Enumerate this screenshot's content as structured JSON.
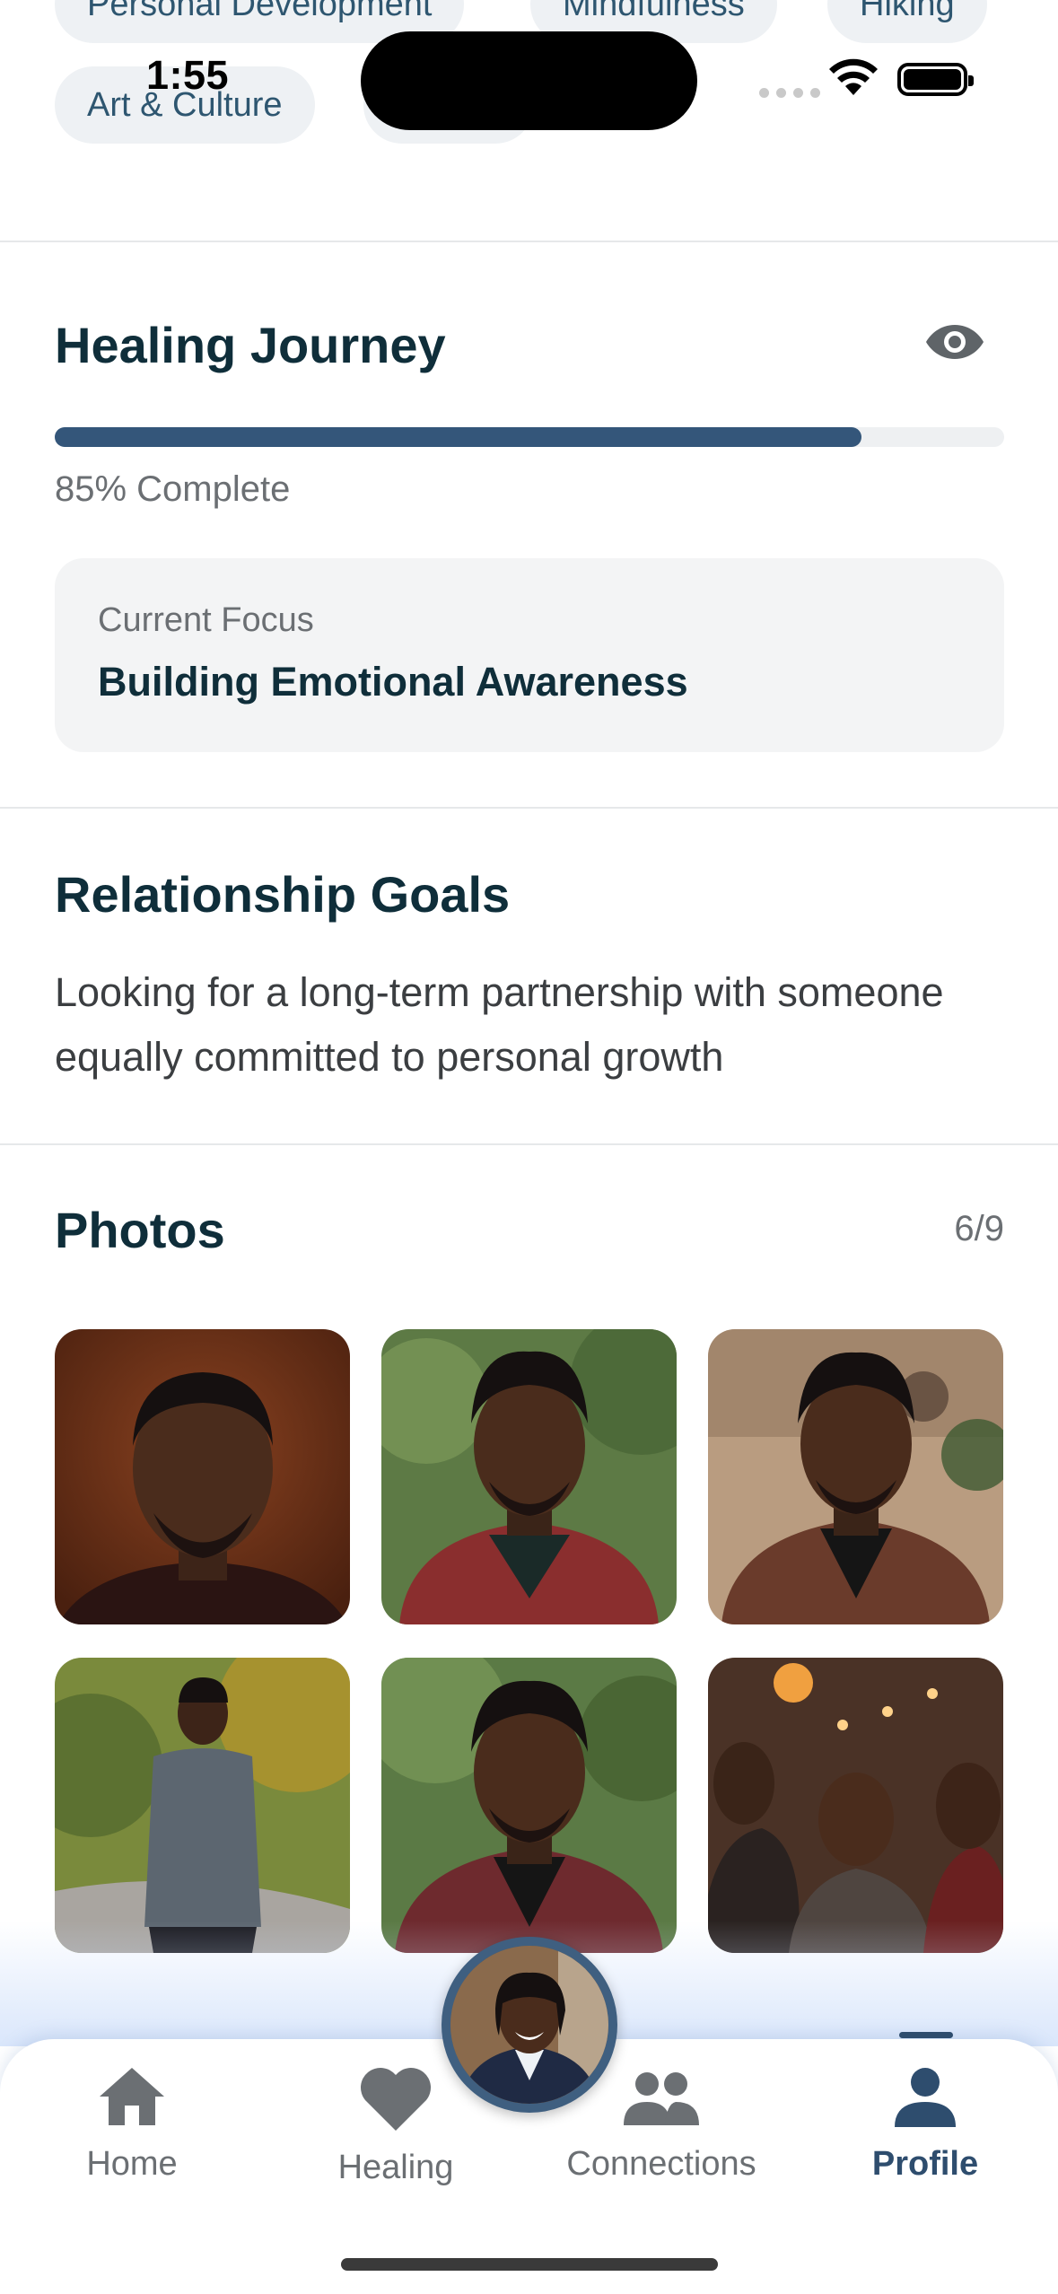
{
  "status_bar": {
    "time": "1:55"
  },
  "interests": [
    "Personal Development",
    "Mindfulness",
    "Hiking",
    "Art & Culture",
    ""
  ],
  "healing": {
    "title": "Healing Journey",
    "progress": 0.85,
    "progress_text": "85% Complete",
    "focus_label": "Current Focus",
    "focus_value": "Building Emotional Awareness"
  },
  "relationship": {
    "title": "Relationship Goals",
    "text": "Looking for a long-term partnership with someone equally committed to personal growth"
  },
  "photos": {
    "title": "Photos",
    "count": "6/9",
    "items": [
      {
        "icon": "portrait-photo",
        "bg": "#6b2f18"
      },
      {
        "icon": "portrait-photo",
        "bg": "#5d7a45"
      },
      {
        "icon": "portrait-photo",
        "bg": "#b99c80"
      },
      {
        "icon": "running-photo",
        "bg": "#7a8a3c"
      },
      {
        "icon": "portrait-photo",
        "bg": "#5b7a45"
      },
      {
        "icon": "social-photo",
        "bg": "#4a3226"
      }
    ]
  },
  "tabbar": {
    "tabs": [
      {
        "label": "Home",
        "icon": "home-icon",
        "active": false
      },
      {
        "label": "Healing",
        "icon": "heart-icon",
        "active": false
      },
      {
        "label": "Connections",
        "icon": "people-icon",
        "active": false
      },
      {
        "label": "Profile",
        "icon": "person-icon",
        "active": true
      }
    ]
  },
  "colors": {
    "accent": "#2e4d6e",
    "progress_fill": "#34567a",
    "text_primary": "#0f2e3a",
    "text_secondary": "#6b6f73",
    "chip_bg": "#eef1f4",
    "card_bg": "#f3f4f5"
  }
}
